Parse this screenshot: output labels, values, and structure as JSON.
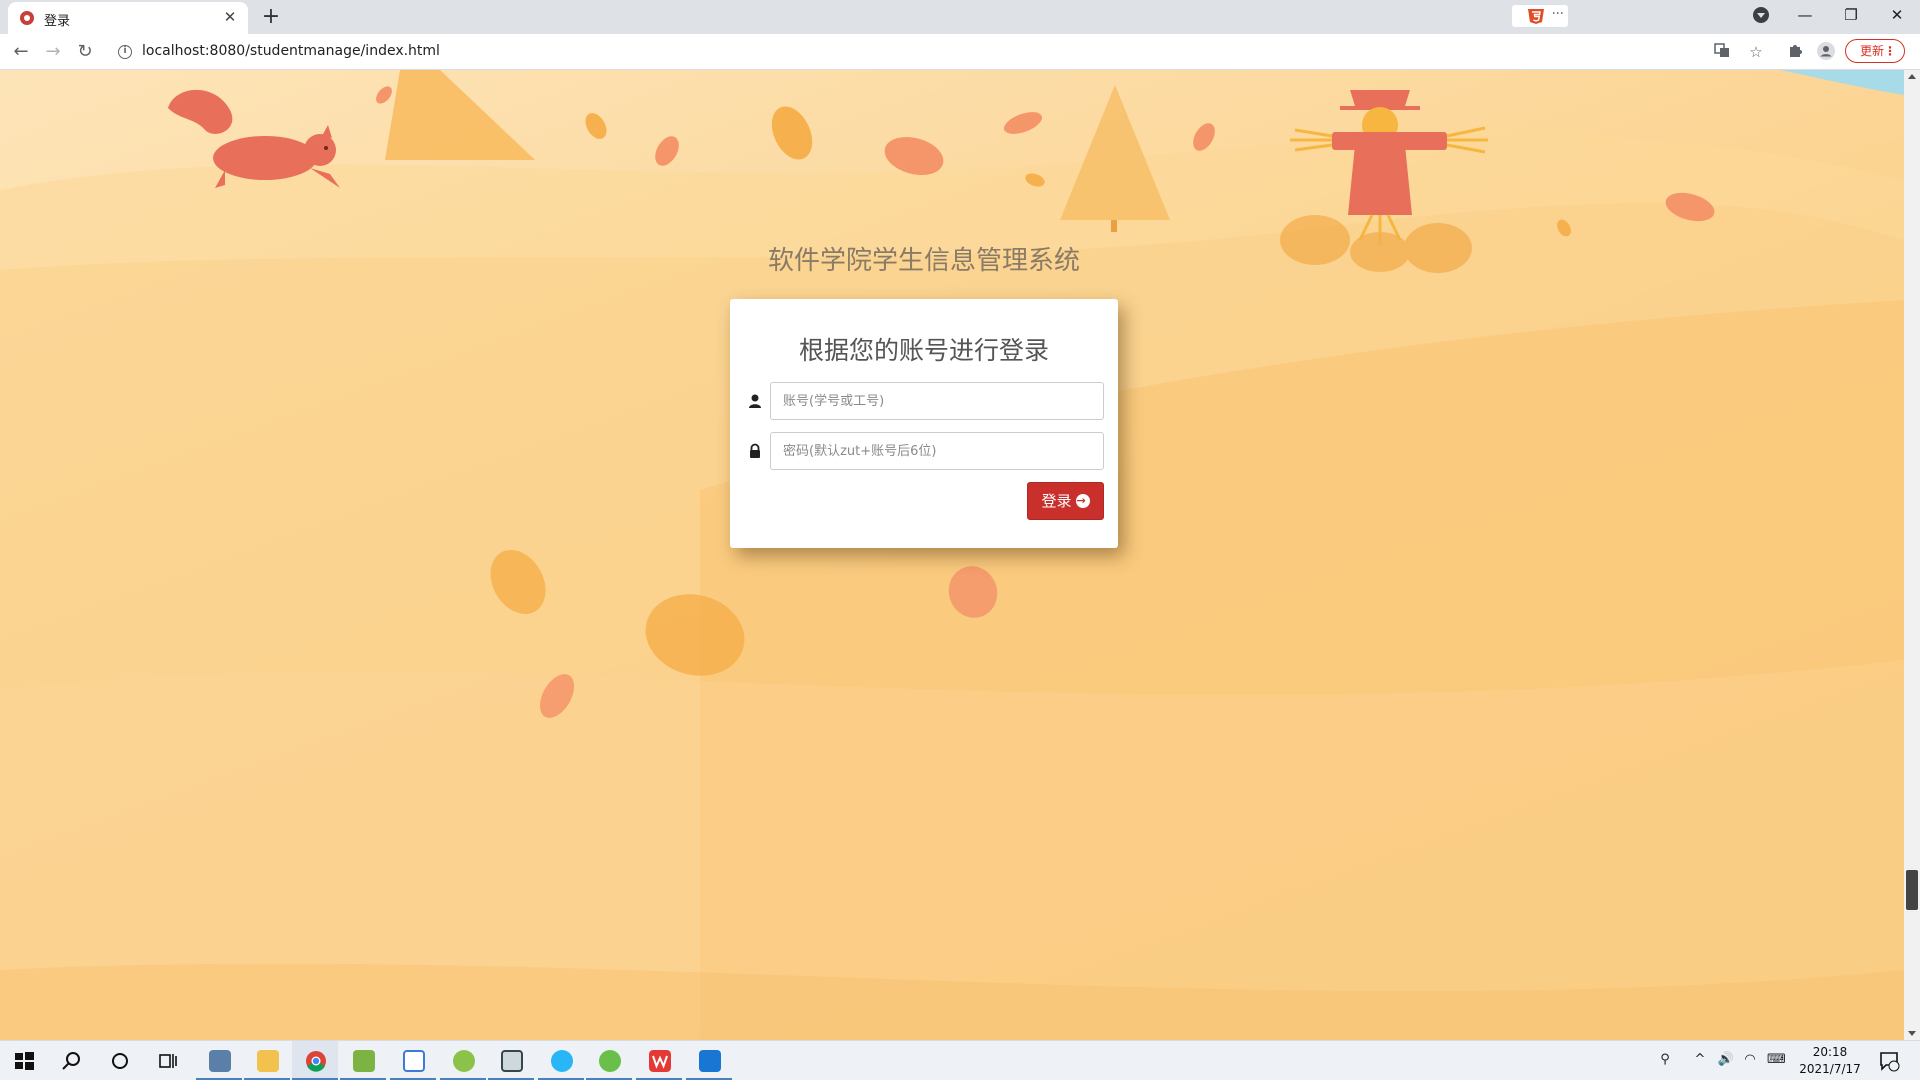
{
  "browser": {
    "tab_title": "登录",
    "tab_close": "✕",
    "new_tab": "+",
    "url": "localhost:8080/studentmanage/index.html",
    "update_label": "更新",
    "window_controls": {
      "minimize": "—",
      "restore": "❐",
      "close": "✕"
    }
  },
  "page": {
    "system_title": "软件学院学生信息管理系统",
    "login_heading": "根据您的账号进行登录",
    "account_placeholder": "账号(学号或工号)",
    "password_placeholder": "密码(默认zut+账号后6位)",
    "login_button": "登录"
  },
  "taskbar": {
    "apps": [
      "start",
      "search",
      "cortana",
      "task-view",
      "app-1",
      "file-explorer",
      "chrome",
      "app-notepad",
      "app-4",
      "app-5",
      "app-6",
      "app-7",
      "app-8",
      "wps",
      "app-10"
    ],
    "time": "20:18",
    "date": "2021/7/17"
  },
  "colors": {
    "accent_red": "#c9302c",
    "bg_light": "#fde4b8",
    "bg_dark": "#f8c470",
    "leaf": "#f7b25a",
    "squirrel": "#e8705a"
  }
}
